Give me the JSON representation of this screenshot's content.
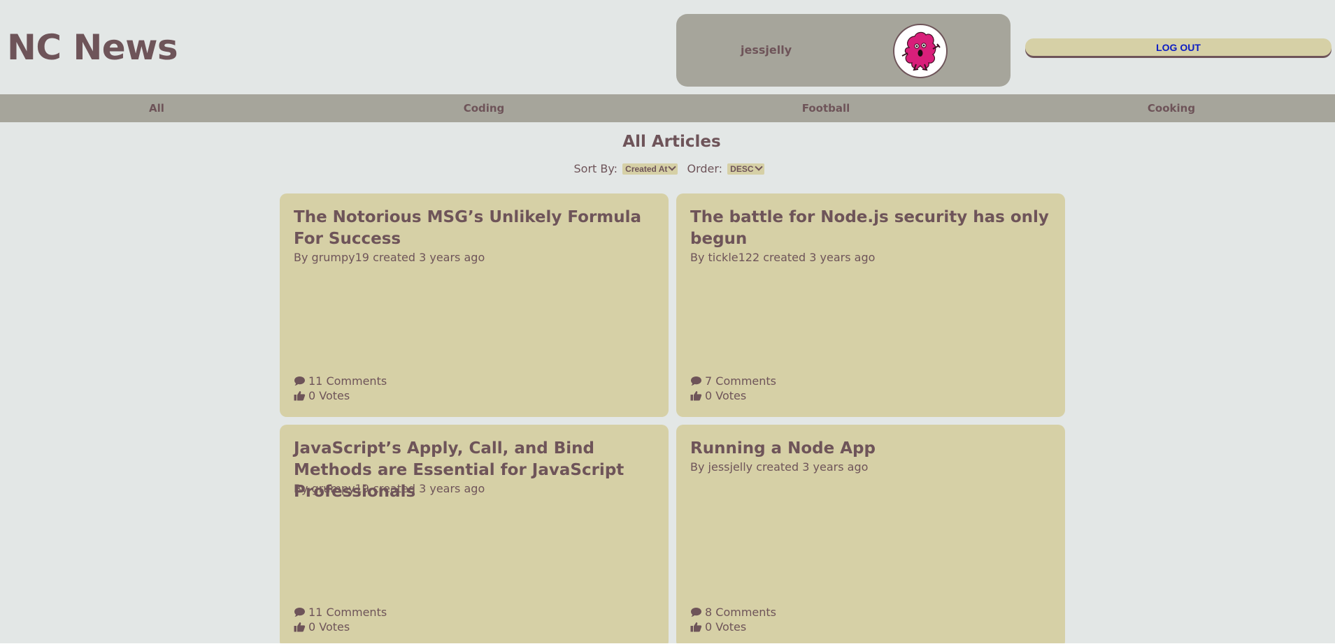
{
  "header": {
    "title": "NC News",
    "user": {
      "username": "jessjelly",
      "avatar_icon": "jelly-monster-icon"
    },
    "logout_label": "LOG OUT"
  },
  "nav": {
    "topics": [
      "All",
      "Coding",
      "Football",
      "Cooking"
    ]
  },
  "main": {
    "heading": "All Articles",
    "sort": {
      "sort_by_label": "Sort By:",
      "sort_by_value": "Created At",
      "order_label": "Order:",
      "order_value": "DESC"
    },
    "articles": [
      {
        "title": "The Notorious MSG’s Unlikely Formula For Success",
        "byline": "By grumpy19 created 3 years ago",
        "comments": "11 Comments",
        "votes": "0 Votes"
      },
      {
        "title": "The battle for Node.js security has only begun",
        "byline": "By tickle122 created 3 years ago",
        "comments": "7 Comments",
        "votes": "0 Votes"
      },
      {
        "title": "JavaScript’s Apply, Call, and Bind Methods are Essential for JavaScript Professionals",
        "byline": "By grumpy19 created 3 years ago",
        "comments": "11 Comments",
        "votes": "0 Votes"
      },
      {
        "title": "Running a Node App",
        "byline": "By jessjelly created 3 years ago",
        "comments": "8 Comments",
        "votes": "0 Votes"
      }
    ]
  },
  "colors": {
    "background": "#e3e7e6",
    "panel": "#a6a59b",
    "card": "#d6d0a6",
    "text": "#6e5459",
    "logout_text": "#0b1bc4",
    "avatar_pink": "#d81f7a"
  },
  "icons": {
    "comments": "comment-icon",
    "votes": "thumbs-up-icon"
  }
}
